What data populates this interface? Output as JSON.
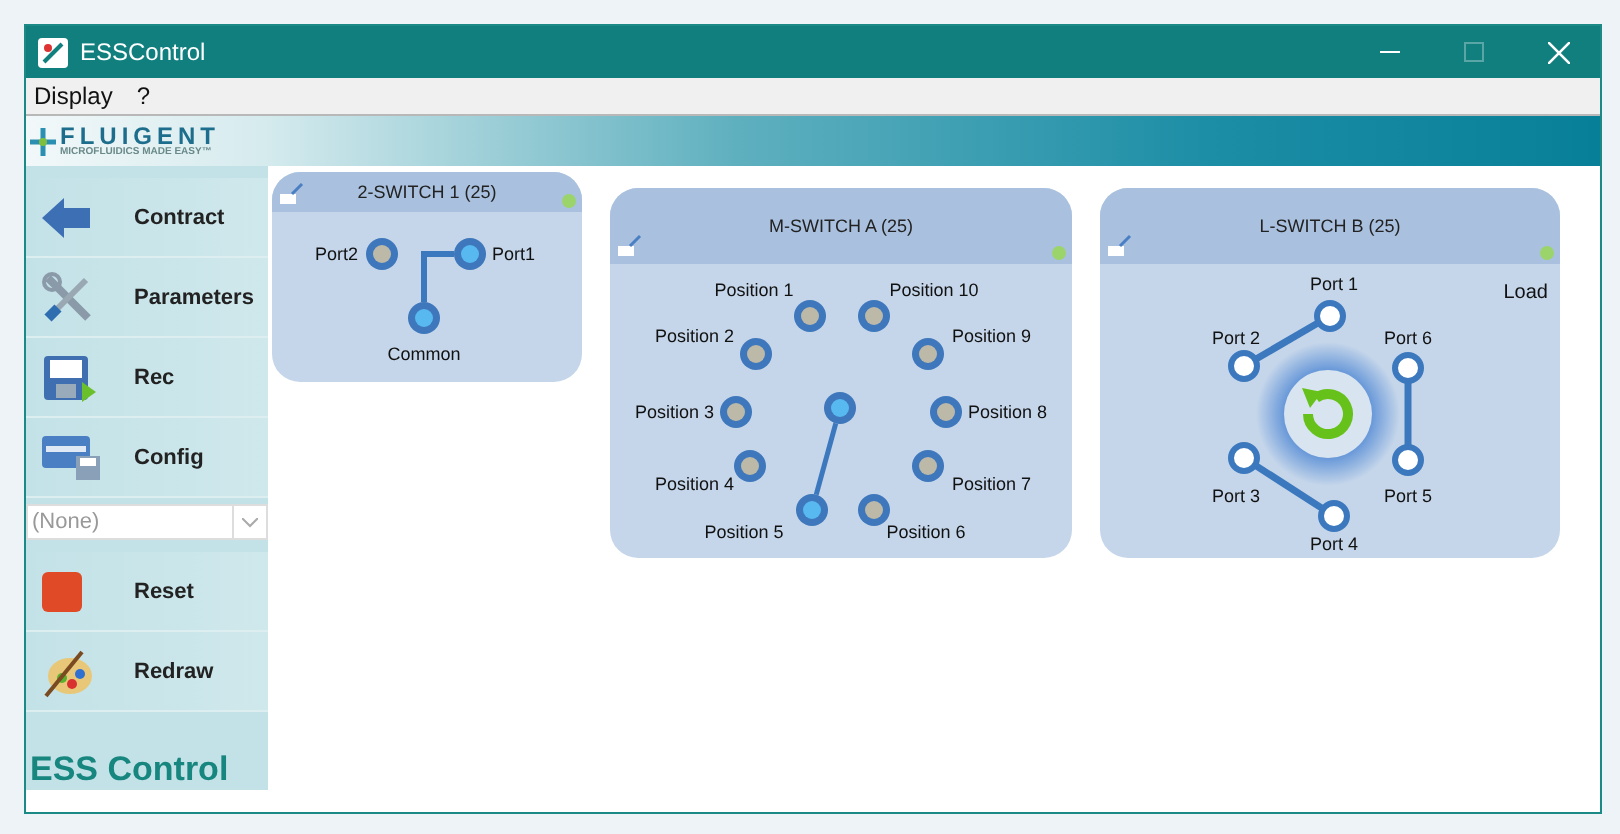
{
  "window": {
    "title": "ESSControl",
    "maximize_disabled": true
  },
  "menu": [
    "Display",
    "?"
  ],
  "logo": {
    "name": "FLUIGENT",
    "tagline": "MICROFLUIDICS MADE EASY™"
  },
  "sidebar": {
    "items": [
      {
        "kind": "contract",
        "label": "Contract"
      },
      {
        "kind": "parameters",
        "label": "Parameters"
      },
      {
        "kind": "rec",
        "label": "Rec"
      },
      {
        "kind": "config",
        "label": "Config"
      },
      {
        "kind": "dropdown",
        "value": "(None)",
        "disabled": true
      },
      {
        "kind": "reset",
        "label": "Reset"
      },
      {
        "kind": "redraw",
        "label": "Redraw"
      }
    ],
    "footer": "ESS Control"
  },
  "switches": [
    {
      "kind": "two",
      "title": "2-SWITCH 1 (25)",
      "online": true,
      "ports": [
        {
          "label": "Port2",
          "selected": false
        },
        {
          "label": "Port1",
          "selected": true
        },
        {
          "label": "Common",
          "selected": true
        }
      ]
    },
    {
      "kind": "multi",
      "title": "M-SWITCH A (25)",
      "online": true,
      "ports": [
        {
          "label": "Position 1",
          "selected": false
        },
        {
          "label": "Position 10",
          "selected": false
        },
        {
          "label": "Position 2",
          "selected": false
        },
        {
          "label": "Position 9",
          "selected": false
        },
        {
          "label": "Position 3",
          "selected": false
        },
        {
          "label": "Position 8",
          "selected": false
        },
        {
          "label": "Position 4",
          "selected": false
        },
        {
          "label": "Position 7",
          "selected": false
        },
        {
          "label": "Position 5",
          "selected": true
        },
        {
          "label": "Position 6",
          "selected": false
        }
      ]
    },
    {
      "kind": "loop",
      "title": "L-SWITCH B (25)",
      "online": true,
      "state": "Load",
      "rotated": false,
      "ports": [
        {
          "label": "Port 1"
        },
        {
          "label": "Port 2"
        },
        {
          "label": "Port 6"
        },
        {
          "label": "Port 3"
        },
        {
          "label": "Port 5"
        },
        {
          "label": "Port 4"
        }
      ]
    }
  ]
}
